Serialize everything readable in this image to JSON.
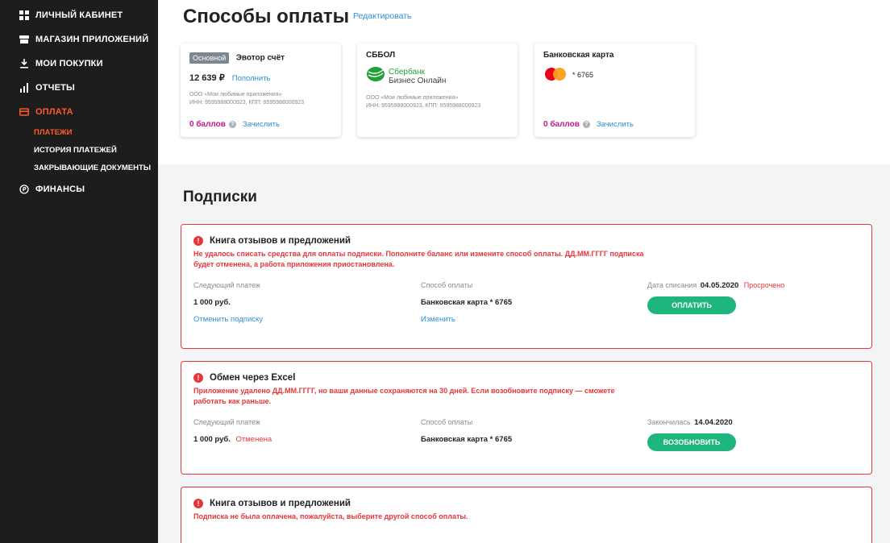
{
  "sidebar": {
    "items": [
      {
        "label": "ЛИЧНЫЙ КАБИНЕТ",
        "icon": "grid-icon"
      },
      {
        "label": "МАГАЗИН ПРИЛОЖЕНИЙ",
        "icon": "store-icon"
      },
      {
        "label": "МОИ ПОКУПКИ",
        "icon": "download-icon"
      },
      {
        "label": "ОТЧЕТЫ",
        "icon": "bar-chart-icon"
      },
      {
        "label": "ОПЛАТА",
        "icon": "credit-card-icon"
      },
      {
        "label": "ФИНАНСЫ",
        "icon": "ruble-circle-icon"
      }
    ],
    "sub_items": [
      "ПЛАТЕЖИ",
      "ИСТОРИЯ ПЛАТЕЖЕЙ",
      "ЗАКРЫВАЮЩИЕ ДОКУМЕНТЫ"
    ]
  },
  "payment_methods": {
    "title": "Способы оплаты",
    "edit_label": "Редактировать",
    "cards": [
      {
        "badge": "Основной",
        "title": "Эвотор счёт",
        "balance": "12 639 ₽",
        "topup_label": "Пополнить",
        "org_name": "ООО «Мои любимые приложения»",
        "org_ids": "ИНН: 9595988000923, КПП: 9595988000923",
        "points": "0 баллов",
        "credit_label": "Зачислить"
      },
      {
        "title": "СББОЛ",
        "logo_name": "Сбербанк",
        "logo_sub": "Бизнес Онлайн",
        "org_name": "ООО «Мои любимые приложения»",
        "org_ids": "ИНН: 9595988000923, КПП: 9595988000923"
      },
      {
        "title": "Банковская карта",
        "card_mask": "* 6765",
        "points": "0 баллов",
        "credit_label": "Зачислить"
      }
    ]
  },
  "subscriptions": {
    "title": "Подписки",
    "items": [
      {
        "name": "Книга отзывов и предложений",
        "message": "Не удалось списать средства для оплаты подписки. Пополните баланс или измените способ оплаты. ДД.ММ.ГГГГ подписка будет отменена, а работа приложения приостановлена.",
        "next_payment_label": "Следующий платеж",
        "next_payment_value": "1 000 руб.",
        "cancel_label": "Отменить подписку",
        "method_label": "Способ оплаты",
        "method_value": "Банковская карта * 6765",
        "change_label": "Изменить",
        "date_label": "Дата списания",
        "date_value": "04.05.2020",
        "date_status": "Просрочено",
        "action_label": "ОПЛАТИТЬ"
      },
      {
        "name": "Обмен через Excel",
        "message": "Приложение удалено ДД.ММ.ГГГГ, но ваши данные сохраняются на 30 дней. Если возобновите подписку — сможете работать как раньше.",
        "next_payment_label": "Следующий платеж",
        "next_payment_value": "1 000 руб.",
        "next_payment_status": "Отменена",
        "method_label": "Способ оплаты",
        "method_value": "Банковская карта * 6765",
        "date_label": "Закончилась",
        "date_value": "14.04.2020",
        "action_label": "ВОЗОБНОВИТЬ"
      },
      {
        "name": "Книга отзывов и предложений",
        "message": "Подписка не была оплачена, пожалуйста, выберите другой способ оплаты."
      }
    ]
  },
  "colors": {
    "sidebar_bg": "#1d1d1d",
    "accent_orange": "#ff5a2b",
    "link_blue": "#2a8fd8",
    "error_red": "#e8353b",
    "success_green": "#1fb67d",
    "points_magenta": "#c0188f"
  }
}
